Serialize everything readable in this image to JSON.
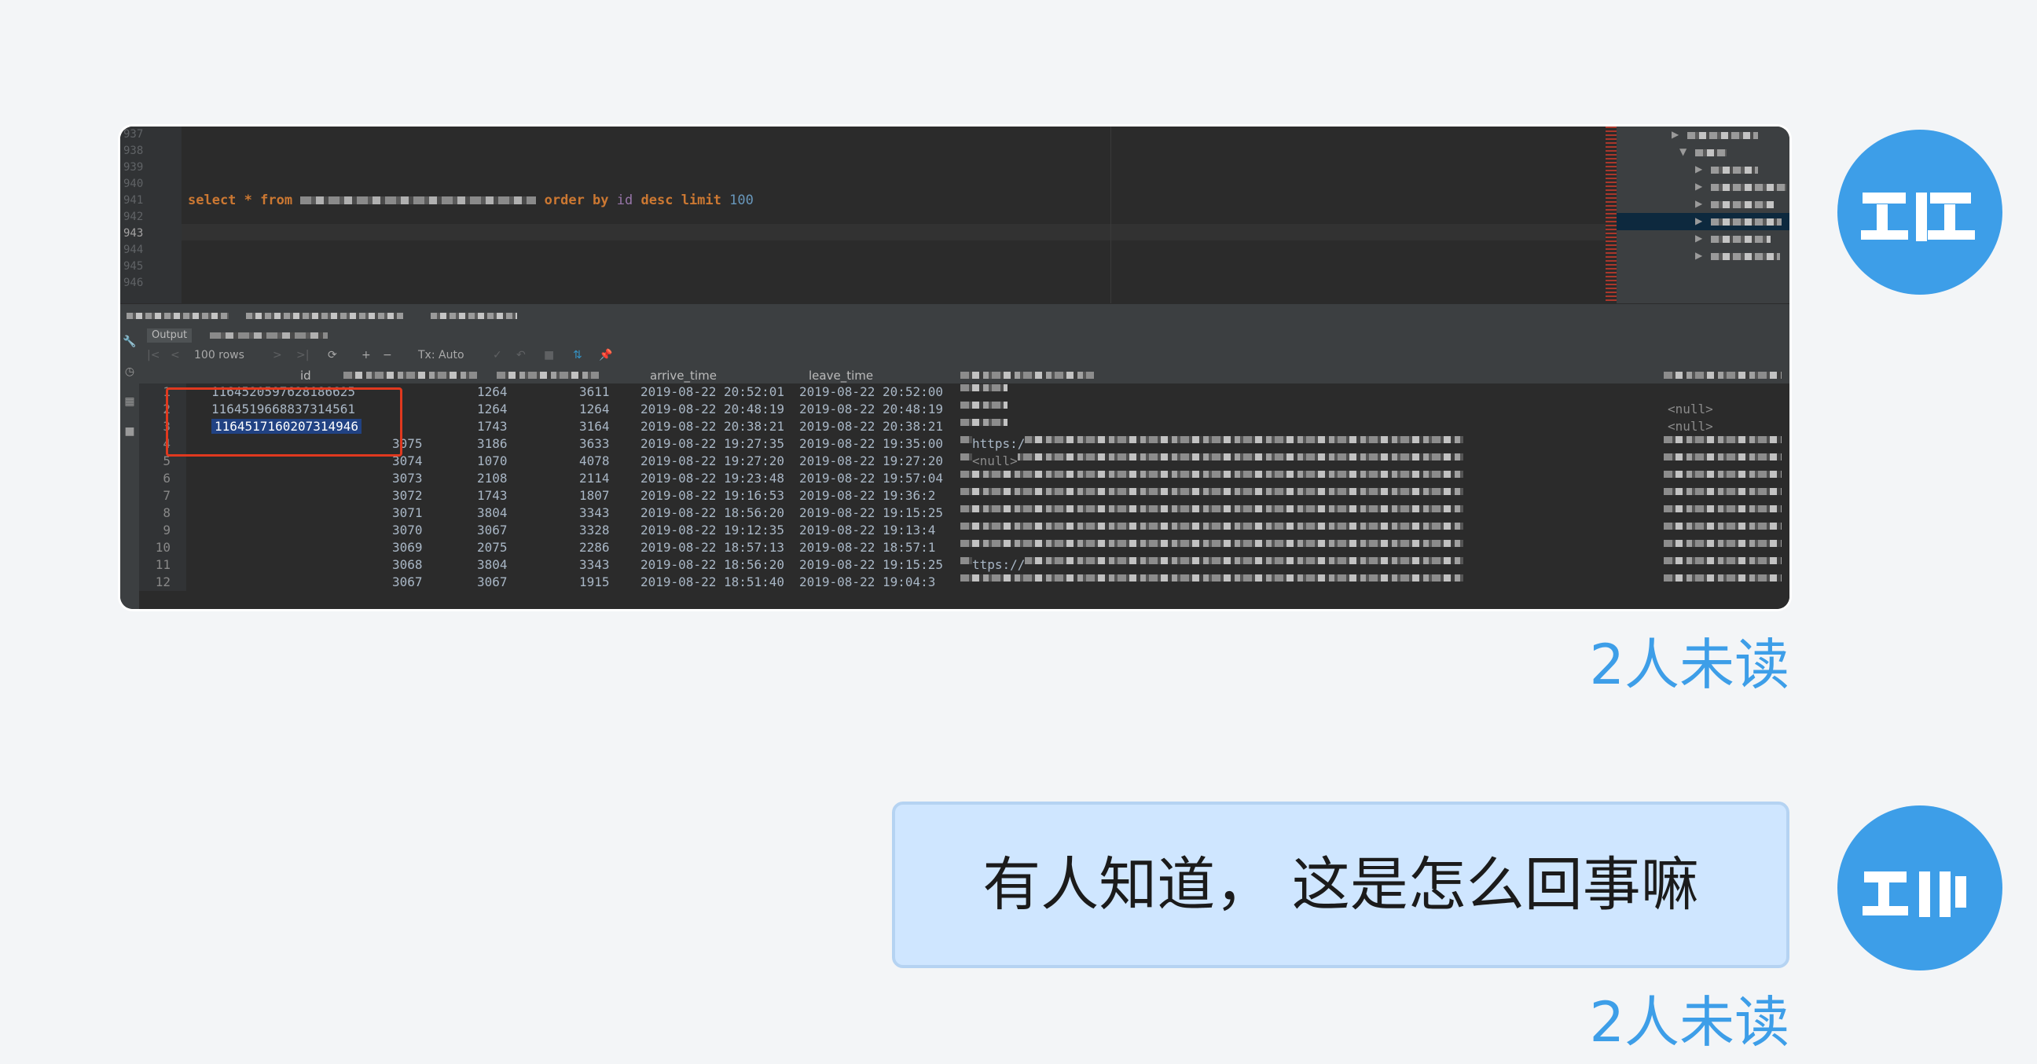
{
  "screenshot": {
    "line_numbers": [
      "937",
      "938",
      "939",
      "940",
      "941",
      "942",
      "943",
      "944",
      "945",
      "946"
    ],
    "current_line": "943",
    "sql": {
      "select": "select",
      "star": "*",
      "from": "from",
      "order_by": "order by",
      "column": "id",
      "desc": "desc",
      "limit": "limit",
      "limit_value": "100"
    },
    "result_tabs": {
      "output": "Output"
    },
    "toolbar": {
      "rows": "100 rows",
      "tx": "Tx: Auto"
    },
    "columns": [
      "id",
      "arrive_time",
      "leave_time"
    ],
    "null_text": "<null>",
    "rows": [
      {
        "n": "1",
        "id": "1164520597628186625",
        "c2": "1264",
        "c3": "3611",
        "arrive": "2019-08-22 20:52:01",
        "leave": "2019-08-22 20:52:00"
      },
      {
        "n": "2",
        "id": "1164519668837314561",
        "c2": "1264",
        "c3": "1264",
        "arrive": "2019-08-22 20:48:19",
        "leave": "2019-08-22 20:48:19"
      },
      {
        "n": "3",
        "id": "1164517160207314946",
        "c2": "1743",
        "c3": "3164",
        "arrive": "2019-08-22 20:38:21",
        "leave": "2019-08-22 20:38:21"
      },
      {
        "n": "4",
        "id": "3075",
        "c2": "3186",
        "c3": "3633",
        "arrive": "2019-08-22 19:27:35",
        "leave": "2019-08-22 19:35:00"
      },
      {
        "n": "5",
        "id": "3074",
        "c2": "1070",
        "c3": "4078",
        "arrive": "2019-08-22 19:27:20",
        "leave": "2019-08-22 19:27:20"
      },
      {
        "n": "6",
        "id": "3073",
        "c2": "2108",
        "c3": "2114",
        "arrive": "2019-08-22 19:23:48",
        "leave": "2019-08-22 19:57:04"
      },
      {
        "n": "7",
        "id": "3072",
        "c2": "1743",
        "c3": "1807",
        "arrive": "2019-08-22 19:16:53",
        "leave": "2019-08-22 19:36:2"
      },
      {
        "n": "8",
        "id": "3071",
        "c2": "3804",
        "c3": "3343",
        "arrive": "2019-08-22 18:56:20",
        "leave": "2019-08-22 19:15:25"
      },
      {
        "n": "9",
        "id": "3070",
        "c2": "3067",
        "c3": "3328",
        "arrive": "2019-08-22 19:12:35",
        "leave": "2019-08-22 19:13:4"
      },
      {
        "n": "10",
        "id": "3069",
        "c2": "2075",
        "c3": "2286",
        "arrive": "2019-08-22 18:57:13",
        "leave": "2019-08-22 18:57:1"
      },
      {
        "n": "11",
        "id": "3068",
        "c2": "3804",
        "c3": "3343",
        "arrive": "2019-08-22 18:56:20",
        "leave": "2019-08-22 19:15:25"
      },
      {
        "n": "12",
        "id": "3067",
        "c2": "3067",
        "c3": "1915",
        "arrive": "2019-08-22 18:51:40",
        "leave": "2019-08-22 19:04:3"
      }
    ],
    "url_fragment": "https:/",
    "url_fragment2": "ttps://"
  },
  "unread_label_1": "2人未读",
  "message_text": "有人知道， 这是怎么回事嘛",
  "unread_label_2": "2人未读",
  "colors": {
    "background": "#f3f5f7",
    "bubble": "#cfe6ff",
    "accent": "#3d9ee8",
    "highlight_box": "#e0391f"
  }
}
